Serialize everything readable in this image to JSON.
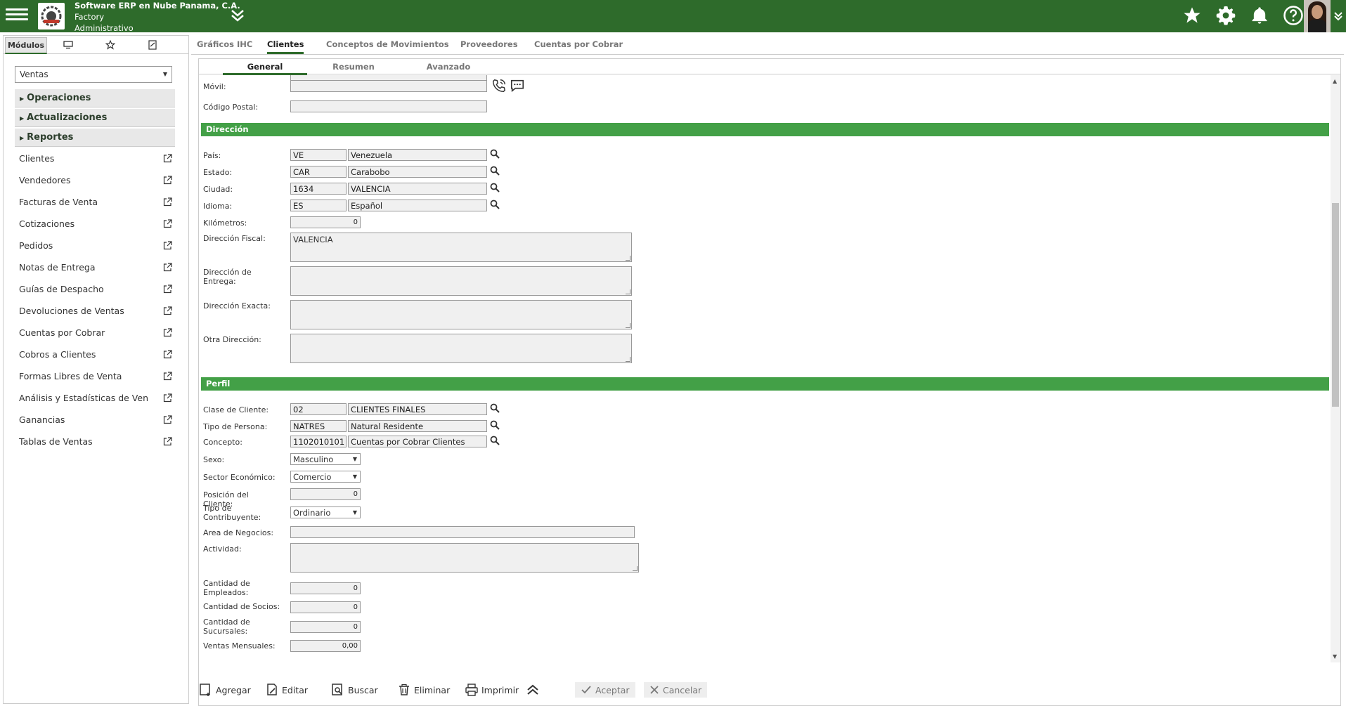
{
  "header": {
    "company": "Software ERP en Nube Panama, C.A.",
    "line2": "Factory",
    "line3": "Administrativo"
  },
  "sidebar": {
    "tabs": [
      {
        "label": "Módulos"
      }
    ],
    "module_select": "Ventas",
    "sections": [
      "Operaciones",
      "Actualizaciones",
      "Reportes"
    ],
    "links": [
      "Clientes",
      "Vendedores",
      "Facturas de Venta",
      "Cotizaciones",
      "Pedidos",
      "Notas de Entrega",
      "Guías de Despacho",
      "Devoluciones de Ventas",
      "Cuentas por Cobrar",
      "Cobros a Clientes",
      "Formas Libres de Venta",
      "Análisis y Estadísticas de Ven",
      "Ganancias",
      "Tablas de Ventas"
    ]
  },
  "main_tabs": [
    "Gráficos IHC",
    "Clientes",
    "Conceptos de Movimientos",
    "Proveedores",
    "Cuentas por Cobrar"
  ],
  "inner_tabs": [
    "General",
    "Resumen",
    "Avanzado"
  ],
  "form": {
    "movil_label": "Móvil:",
    "cp_label": "Código Postal:",
    "sec_direccion": "Dirección",
    "pais_label": "País:",
    "pais_code": "VE",
    "pais_name": "Venezuela",
    "estado_label": "Estado:",
    "estado_code": "CAR",
    "estado_name": "Carabobo",
    "ciudad_label": "Ciudad:",
    "ciudad_code": "1634",
    "ciudad_name": "VALENCIA",
    "idioma_label": "Idioma:",
    "idioma_code": "ES",
    "idioma_name": "Español",
    "km_label": "Kilómetros:",
    "km_value": "0",
    "dfiscal_label": "Dirección Fiscal:",
    "dfiscal_value": "VALENCIA",
    "dentrega_label": "Dirección de Entrega:",
    "dexacta_label": "Dirección Exacta:",
    "otra_label": "Otra Dirección:",
    "sec_perfil": "Perfil",
    "clase_label": "Clase de Cliente:",
    "clase_code": "02",
    "clase_name": "CLIENTES FINALES",
    "tipo_label": "Tipo de Persona:",
    "tipo_code": "NATRES",
    "tipo_name": "Natural Residente",
    "concepto_label": "Concepto:",
    "concepto_code": "1102010101",
    "concepto_name": "Cuentas por Cobrar Clientes",
    "sexo_label": "Sexo:",
    "sexo_value": "Masculino",
    "sector_label": "Sector Económico:",
    "sector_value": "Comercio",
    "posicion_label": "Posición del Cliente:",
    "posicion_value": "0",
    "contrib_label": "Tipo de Contribuyente:",
    "contrib_value": "Ordinario",
    "area_label": "Area de Negocios:",
    "actividad_label": "Actividad:",
    "empleados_label": "Cantidad de Empleados:",
    "empleados_value": "0",
    "socios_label": "Cantidad de Socios:",
    "socios_value": "0",
    "sucursales_label": "Cantidad de Sucursales:",
    "sucursales_value": "0",
    "ventas_label": "Ventas Mensuales:",
    "ventas_value": "0,00"
  },
  "toolbar": {
    "agregar": "Agregar",
    "editar": "Editar",
    "buscar": "Buscar",
    "eliminar": "Eliminar",
    "imprimir": "Imprimir",
    "aceptar": "Aceptar",
    "cancelar": "Cancelar"
  },
  "colors": {
    "header": "#2e6b2b",
    "section": "#43a047"
  }
}
